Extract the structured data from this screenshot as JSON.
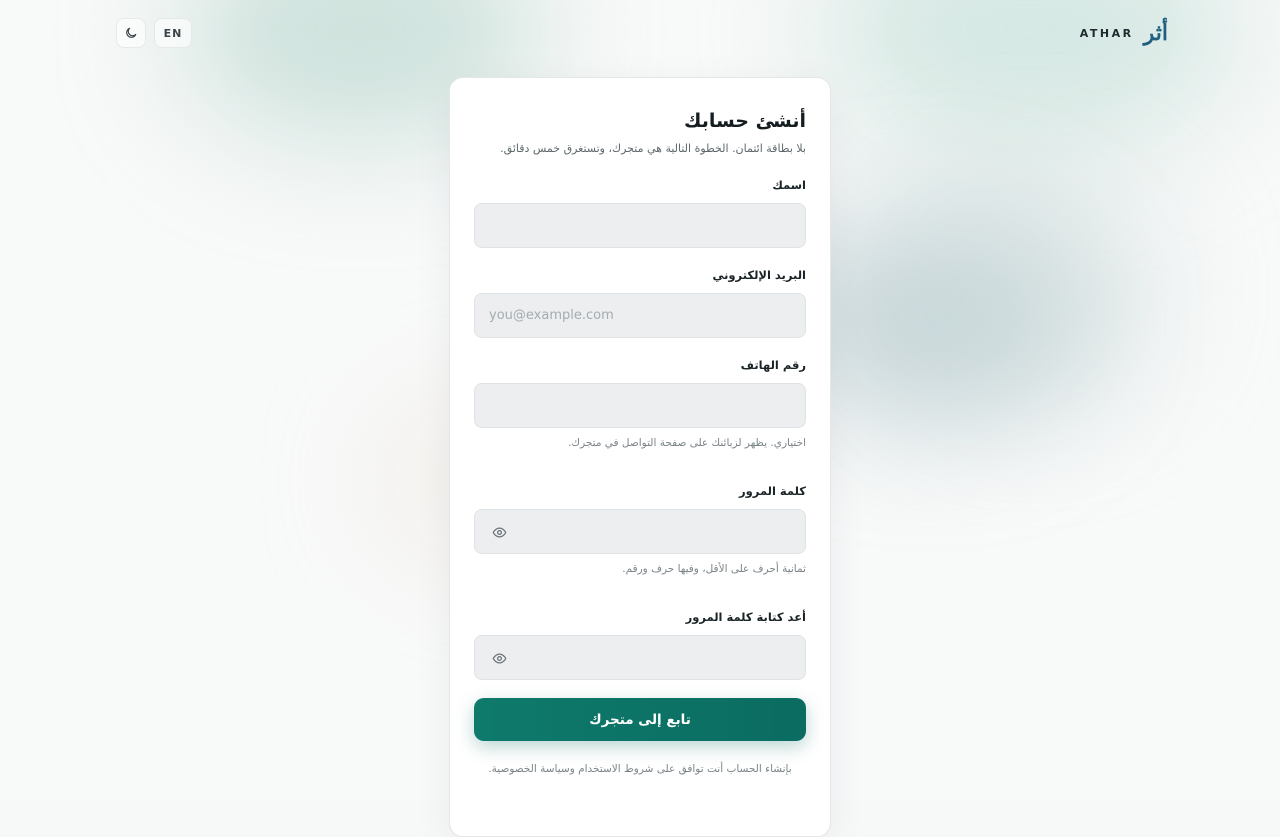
{
  "header": {
    "brand_name": "ATHAR",
    "brand_logo_text": "أثر",
    "lang_toggle_label": "EN",
    "theme_toggle_icon": "moon-icon"
  },
  "signup": {
    "title": "أنشئ حسابك",
    "subtitle": "بلا بطاقة ائتمان. الخطوة التالية هي متجرك، وتستغرق خمس دقائق.",
    "name": {
      "label": "اسمك",
      "value": "",
      "placeholder": ""
    },
    "email": {
      "label": "البريد الإلكتروني",
      "value": "",
      "placeholder": "you@example.com"
    },
    "phone": {
      "label": "رقم الهاتف",
      "value": "",
      "placeholder": "",
      "hint": "اختياري. يظهر لزبائنك على صفحة التواصل في متجرك."
    },
    "password": {
      "label": "كلمة المرور",
      "value": "",
      "placeholder": "",
      "hint": "ثمانية أحرف على الأقل، وفيها حرف ورقم.",
      "toggle_icon": "eye-icon"
    },
    "confirm_password": {
      "label": "أعد كتابة كلمة المرور",
      "value": "",
      "placeholder": "",
      "toggle_icon": "eye-icon"
    },
    "submit_label": "تابع إلى متجرك",
    "terms_text": "بإنشاء الحساب أنت توافق على شروط الاستخدام وسياسة الخصوصية."
  },
  "colors": {
    "accent": "#0b6c61",
    "brand_logo": "#1f5f80",
    "input_bg": "#eceef0"
  }
}
